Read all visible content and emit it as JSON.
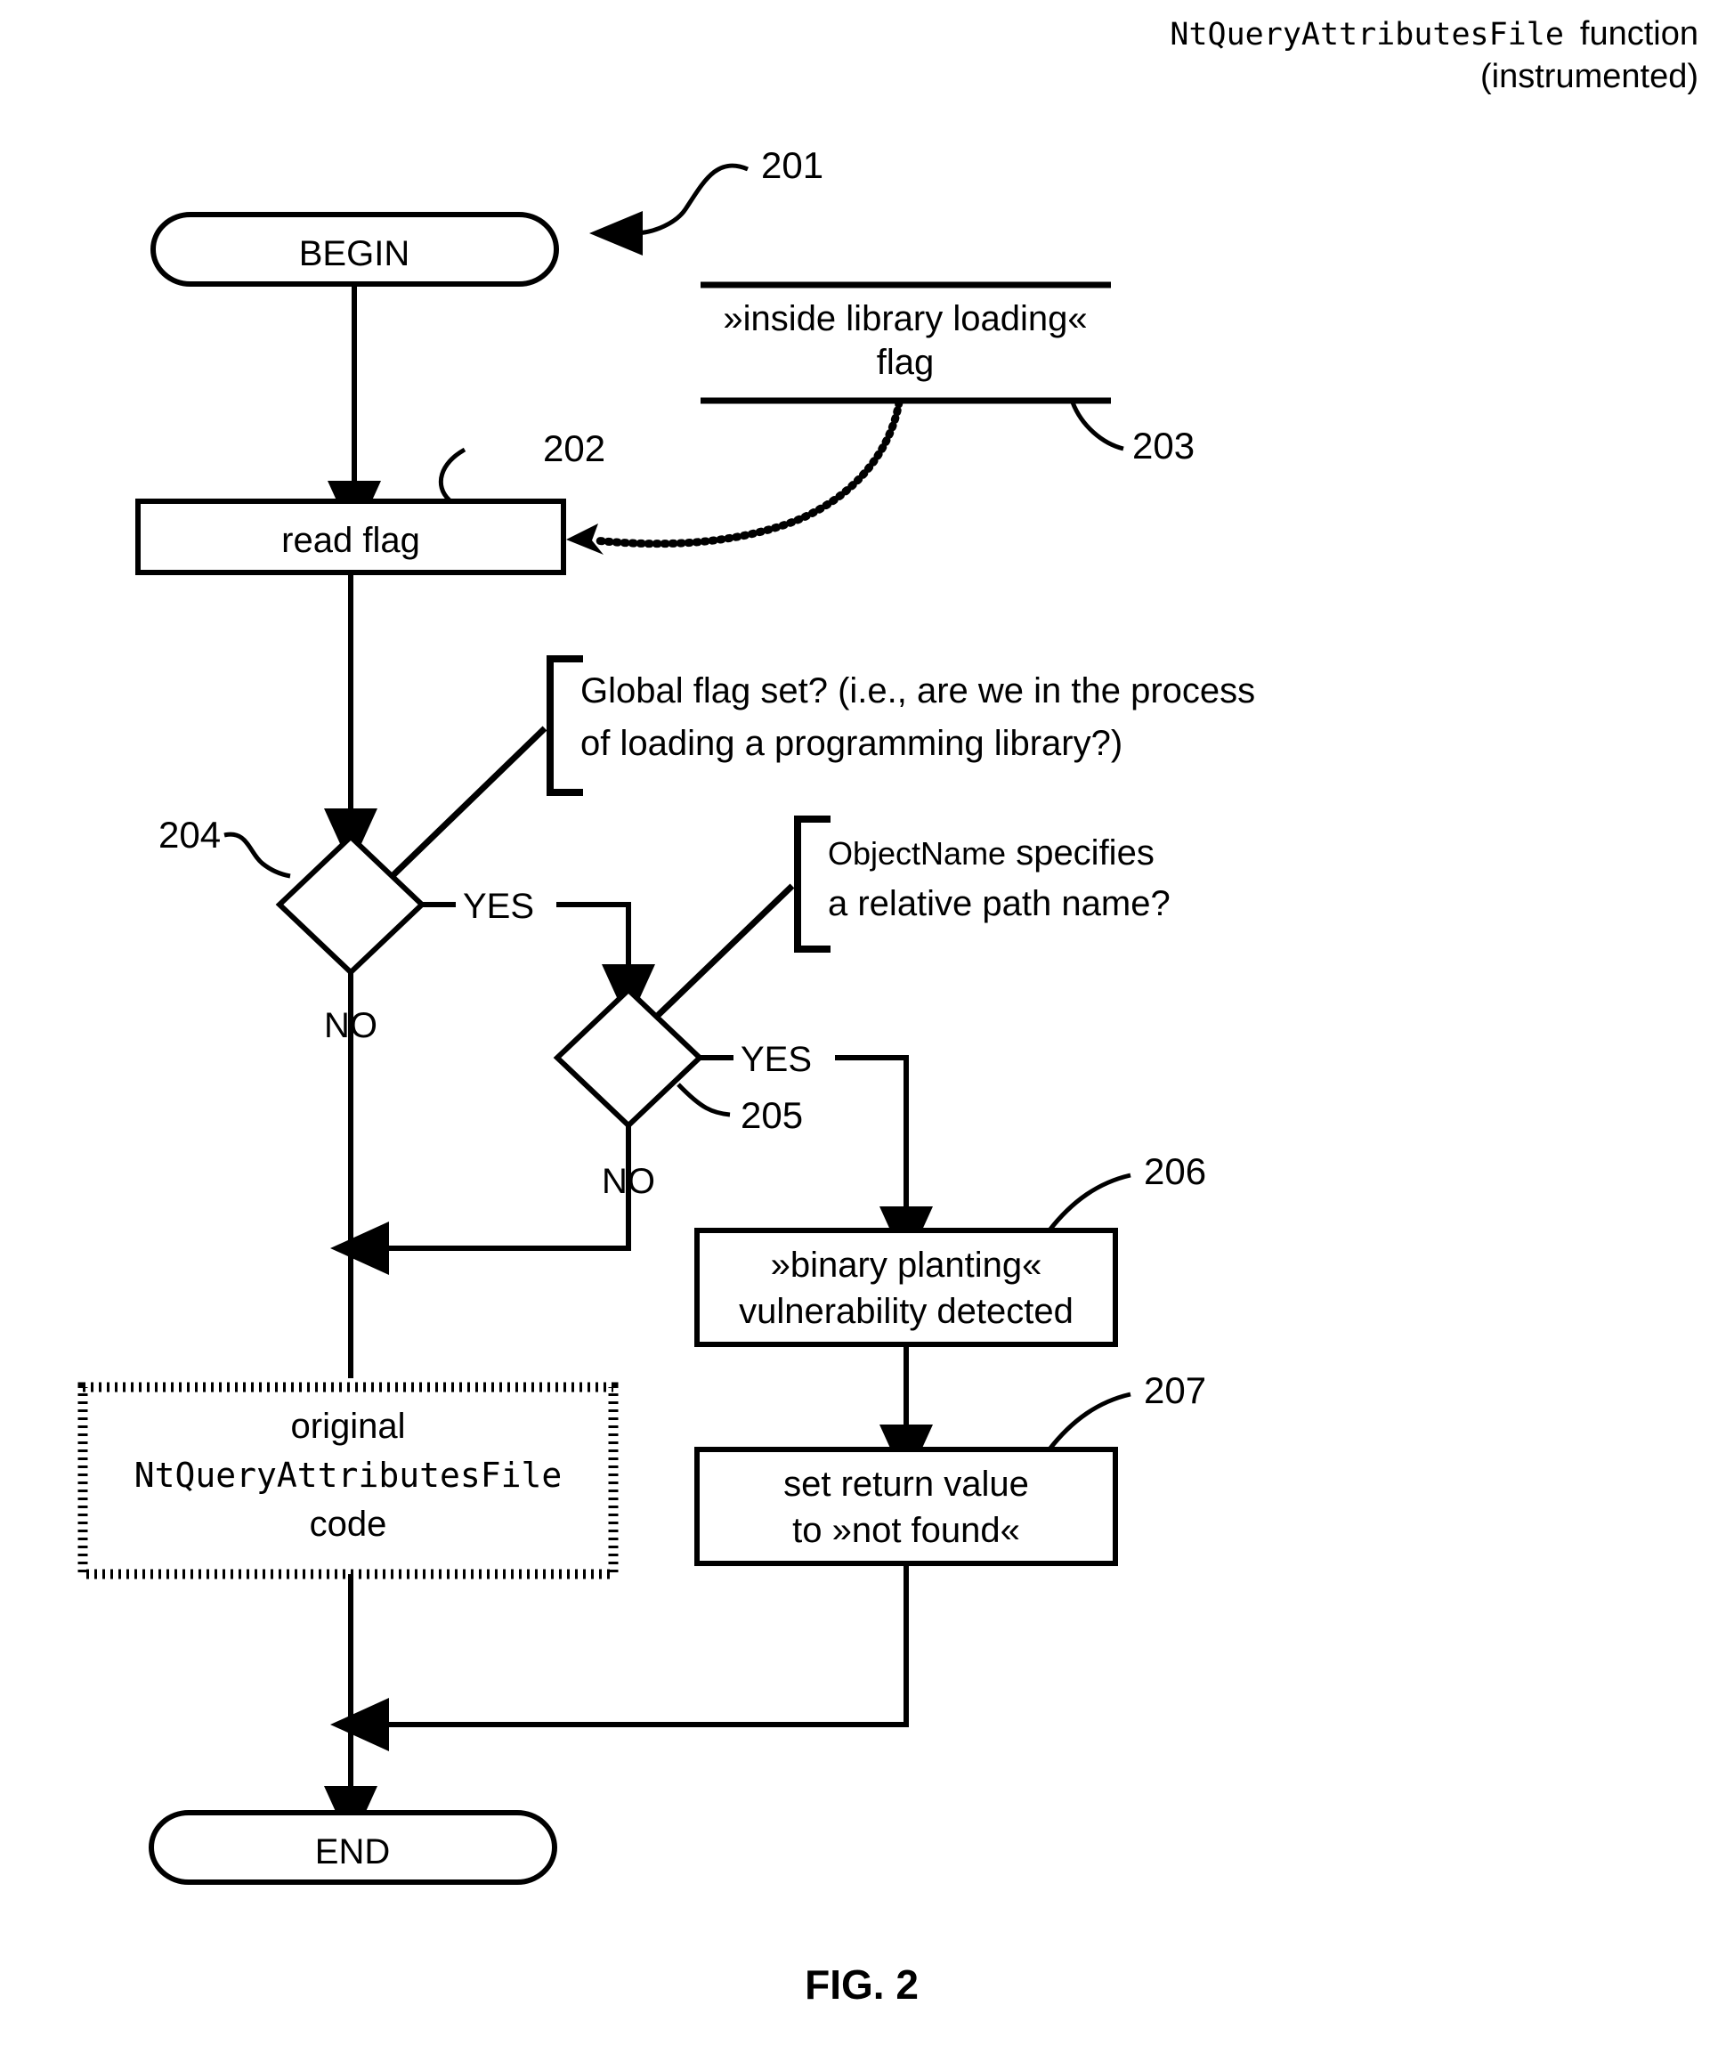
{
  "header": {
    "function_name": "NtQueryAttributesFile",
    "function_word": "function",
    "qualifier": "(instrumented)"
  },
  "figure": {
    "caption": "FIG. 2"
  },
  "nodes": {
    "begin": {
      "label": "BEGIN",
      "shape": "stadium"
    },
    "read_flag": {
      "label": "read flag",
      "shape": "rect",
      "ref": "202"
    },
    "decision_204": {
      "ref": "204",
      "shape": "diamond",
      "yes": "YES",
      "no": "NO"
    },
    "decision_205": {
      "ref": "205",
      "shape": "diamond",
      "yes": "YES",
      "no": "NO"
    },
    "binary_planting": {
      "ref": "206",
      "shape": "rect",
      "line1": "»binary planting«",
      "line2": "vulnerability detected"
    },
    "set_return": {
      "ref": "207",
      "shape": "rect",
      "line1": "set return value",
      "line2": "to »not found«"
    },
    "original_code": {
      "shape": "rect-dotted",
      "line1": "original",
      "line2": "NtQueryAttributesFile",
      "line3": "code"
    },
    "end": {
      "label": "END",
      "shape": "stadium"
    }
  },
  "annotations": {
    "flowchart_ref": "201",
    "flag_store": {
      "ref": "203",
      "line1": "»inside library loading«",
      "line2": "flag"
    },
    "question_204": {
      "line1": "Global flag set? (i.e., are we in the process",
      "line2": "of loading a programming library?)"
    },
    "question_205": {
      "mono_part": "ObjectName",
      "line1_rest": " specifies",
      "line2": "a relative path name?"
    }
  }
}
